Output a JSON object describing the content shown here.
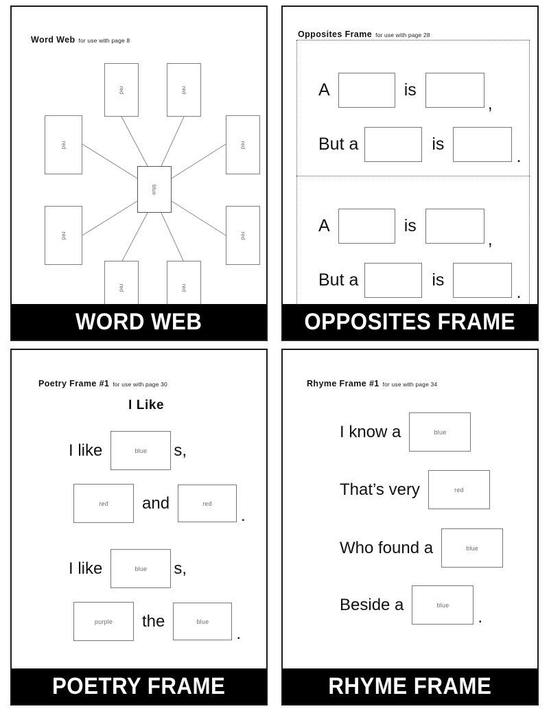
{
  "page": {
    "background": "#ffffff",
    "banner_bg": "#000000",
    "banner_fg": "#ffffff"
  },
  "panels": [
    {
      "id": "word-web",
      "heading": {
        "title": "Word Web",
        "subtitle": "for use with page 8"
      },
      "banner": "WORD WEB",
      "center_node": {
        "label": "blue"
      },
      "outer_nodes": [
        {
          "label": "red"
        },
        {
          "label": "red"
        },
        {
          "label": "red"
        },
        {
          "label": "red"
        },
        {
          "label": "red"
        },
        {
          "label": "red"
        },
        {
          "label": "red"
        },
        {
          "label": "red"
        }
      ]
    },
    {
      "id": "opposites-frame",
      "heading": {
        "title": "Opposites Frame",
        "subtitle": "for use with page 28"
      },
      "banner": "OPPOSITES FRAME",
      "sections": [
        {
          "lines": [
            {
              "before": "A",
              "middle": "is",
              "after": ","
            },
            {
              "before": "But a",
              "middle": "is",
              "after": "."
            }
          ]
        },
        {
          "lines": [
            {
              "before": "A",
              "middle": "is",
              "after": ","
            },
            {
              "before": "But a",
              "middle": "is",
              "after": "."
            }
          ]
        }
      ]
    },
    {
      "id": "poetry-frame",
      "heading": {
        "title": "Poetry Frame #1",
        "subtitle": "for use with page 30"
      },
      "banner": "POETRY FRAME",
      "poem_title": "I Like",
      "lines": [
        {
          "before": "I like",
          "box": "blue",
          "after": "s,"
        },
        {
          "box1": "red",
          "middle": "and",
          "box2": "red",
          "after": "."
        },
        {
          "before": "I like",
          "box": "blue",
          "after": "s,"
        },
        {
          "box1": "purple",
          "middle": "the",
          "box2": "blue",
          "after": "."
        }
      ]
    },
    {
      "id": "rhyme-frame",
      "heading": {
        "title": "Rhyme Frame #1",
        "subtitle": "for use with page 34"
      },
      "banner": "RHYME FRAME",
      "lines": [
        {
          "before": "I know a",
          "box": "blue",
          "after": ""
        },
        {
          "before": "That’s very",
          "box": "red",
          "after": ""
        },
        {
          "before": "Who found a",
          "box": "blue",
          "after": ""
        },
        {
          "before": "Beside a",
          "box": "blue",
          "after": "."
        }
      ]
    }
  ]
}
